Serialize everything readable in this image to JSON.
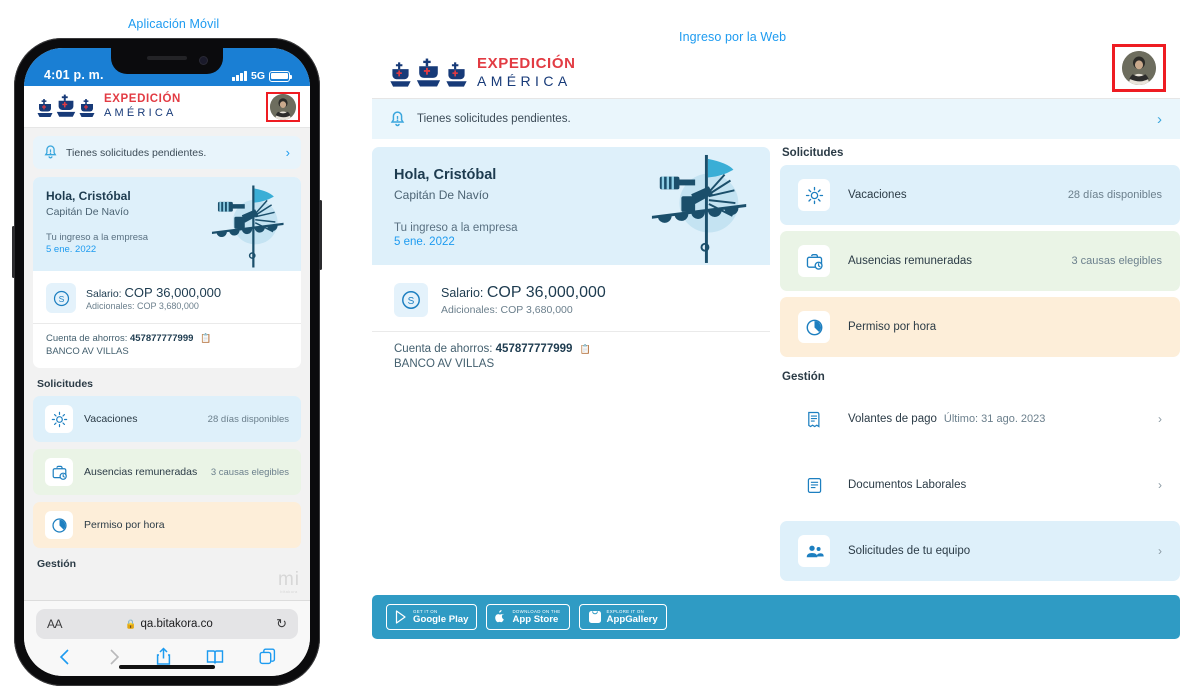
{
  "captions": {
    "mobile": "Aplicación Móvil",
    "web": "Ingreso por la Web"
  },
  "brand": {
    "line1": "EXPEDICIÓN",
    "line2": "AMÉRICA",
    "accent_red": "#e23b43",
    "navy": "#173a78",
    "primary_blue": "#1d9bf0",
    "footer_teal": "#2f9bc4",
    "highlight_red": "#ee1c22"
  },
  "phone": {
    "status": {
      "time": "4:01 p. m.",
      "network": "5G",
      "signal_icon": "signal-bars-icon",
      "battery_icon": "battery-full-icon"
    },
    "safari": {
      "text_size_label": "AA",
      "lock_icon": "lock-icon",
      "url": "qa.bitakora.co",
      "reload_icon": "reload-icon",
      "back_icon": "chevron-left-icon",
      "forward_icon": "chevron-right-icon",
      "share_icon": "share-icon",
      "bookmarks_icon": "book-icon",
      "tabs_icon": "tabs-icon"
    },
    "watermark": {
      "text": "mi",
      "subtext": "bitakora"
    }
  },
  "notice": {
    "icon": "bell-icon",
    "text": "Tienes solicitudes pendientes.",
    "chevron": "›"
  },
  "profile": {
    "greeting": "Hola, Cristóbal",
    "role": "Capitán De Navío",
    "joined_label": "Tu ingreso a la empresa",
    "joined_date": "5 ene. 2022",
    "illustration": "sailor-crows-nest-illustration",
    "salary": {
      "icon": "dollar-coin-icon",
      "label": "Salario:",
      "amount": "COP 36,000,000",
      "extra_label": "Adicionales:",
      "extra_amount": "COP 3,680,000"
    },
    "account": {
      "label": "Cuenta de ahorros:",
      "number": "457877777999",
      "copy_icon": "copy-icon",
      "bank": "BANCO AV VILLAS"
    },
    "avatar": "user-avatar"
  },
  "sections": {
    "solicitudes": {
      "title": "Solicitudes",
      "items": [
        {
          "label": "Vacaciones",
          "meta": "28 días disponibles",
          "icon": "sun-icon",
          "tone": "blue",
          "bg": "#def0fa"
        },
        {
          "label": "Ausencias remuneradas",
          "meta": "3 causas elegibles",
          "icon": "briefcase-clock-icon",
          "tone": "green",
          "bg": "#eaf4e6"
        },
        {
          "label": "Permiso por hora",
          "meta": "",
          "icon": "clock-icon",
          "tone": "peach",
          "bg": "#fdeed9"
        }
      ]
    },
    "gestion": {
      "title": "Gestión",
      "items": [
        {
          "label": "Volantes de pago",
          "meta": "Último: 31 ago. 2023",
          "icon": "payslip-icon",
          "tone": "white",
          "chevron": "›"
        },
        {
          "label": "Documentos Laborales",
          "meta": "",
          "icon": "document-icon",
          "tone": "white",
          "chevron": "›"
        },
        {
          "label": "Solicitudes de tu equipo",
          "meta": "",
          "icon": "team-icon",
          "tone": "blue",
          "chevron": "›"
        }
      ]
    }
  },
  "store_badges": [
    {
      "small": "GET IT ON",
      "big": "Google Play",
      "icon": "google-play-icon"
    },
    {
      "small": "Download on the",
      "big": "App Store",
      "icon": "apple-icon"
    },
    {
      "small": "EXPLORE IT ON",
      "big": "AppGallery",
      "icon": "appgallery-icon"
    }
  ]
}
